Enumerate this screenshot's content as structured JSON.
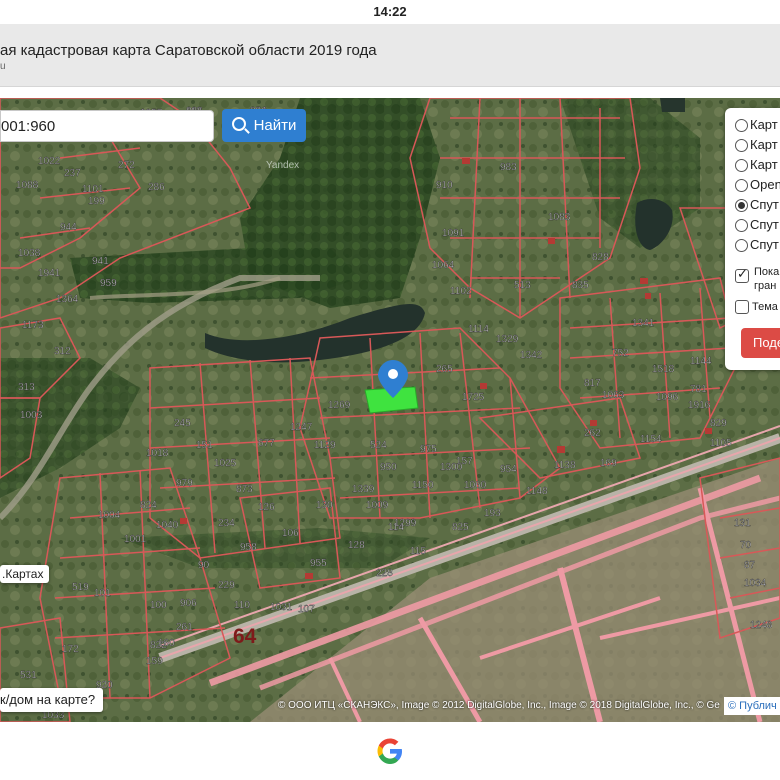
{
  "status": {
    "time": "14:22"
  },
  "page": {
    "title": "ая кадастровая карта Саратовской области 2019 года",
    "subtitle": "u"
  },
  "search": {
    "value": "001:960",
    "button_label": "Найти"
  },
  "layers": {
    "options": [
      {
        "label": "Карт",
        "selected": false
      },
      {
        "label": "Карт",
        "selected": false
      },
      {
        "label": "Карт",
        "selected": false
      },
      {
        "label": "Open",
        "selected": false
      },
      {
        "label": "Спут",
        "selected": true
      },
      {
        "label": "Спут",
        "selected": false
      },
      {
        "label": "Спут",
        "selected": false
      }
    ],
    "checkbox_borders": {
      "line1": "Пока",
      "line2": "гран",
      "checked": true
    },
    "checkbox_thematic": {
      "label": "Тема",
      "checked": false
    },
    "show_button": "Поде"
  },
  "map": {
    "road_label": "64",
    "yandex_label": "Yandex",
    "yandex_maps_chip": ".Картах",
    "house_question_chip": "к/дом на карте?",
    "attribution": "© ООО ИТЦ «СКАНЭКС», Imagе © 2012 DigitalGlobe, Inc., Image © 2018 DigitalGlobe, Inc., © Ge",
    "publish_link": "© Публич",
    "parcel_numbers": [
      "206",
      "113",
      "256",
      "250",
      "1022",
      "237",
      "272",
      "1088",
      "1101",
      "199",
      "286",
      "944",
      "1038",
      "941",
      "1941",
      "959",
      "1364",
      "1173",
      "312",
      "313",
      "1003",
      "910",
      "1091",
      "983",
      "1083",
      "1064",
      "1102",
      "513",
      "835",
      "828",
      "1114",
      "1329",
      "1342",
      "1341",
      "752",
      "1518",
      "1144",
      "781",
      "1916",
      "817",
      "1063",
      "1096",
      "829",
      "1105",
      "1154",
      "262",
      "169",
      "157",
      "265",
      "1269",
      "1725",
      "1247",
      "1129",
      "524",
      "975",
      "677",
      "954",
      "1138",
      "1148",
      "950",
      "1150",
      "1300",
      "1060",
      "245",
      "151",
      "1018",
      "1025",
      "979",
      "873",
      "824",
      "126",
      "106",
      "130",
      "1339",
      "1009",
      "1299",
      "825",
      "193",
      "1004",
      "1001",
      "1040",
      "234",
      "958",
      "114",
      "115",
      "90",
      "229",
      "128",
      "955",
      "228",
      "906",
      "110",
      "1031",
      "107",
      "261",
      "920",
      "101",
      "100",
      "160",
      "531",
      "1033",
      "159",
      "822",
      "172",
      "519",
      "131",
      "70",
      "87",
      "1034",
      "1248",
      "1257",
      "886",
      "884",
      "858"
    ]
  },
  "colors": {
    "search_button": "#2f7fd1",
    "show_button": "#dc4b45",
    "parcel_outline": "#d85858",
    "selected_parcel": "#3fe33f",
    "pin": "#2f7fd1"
  },
  "google_logo": "G"
}
